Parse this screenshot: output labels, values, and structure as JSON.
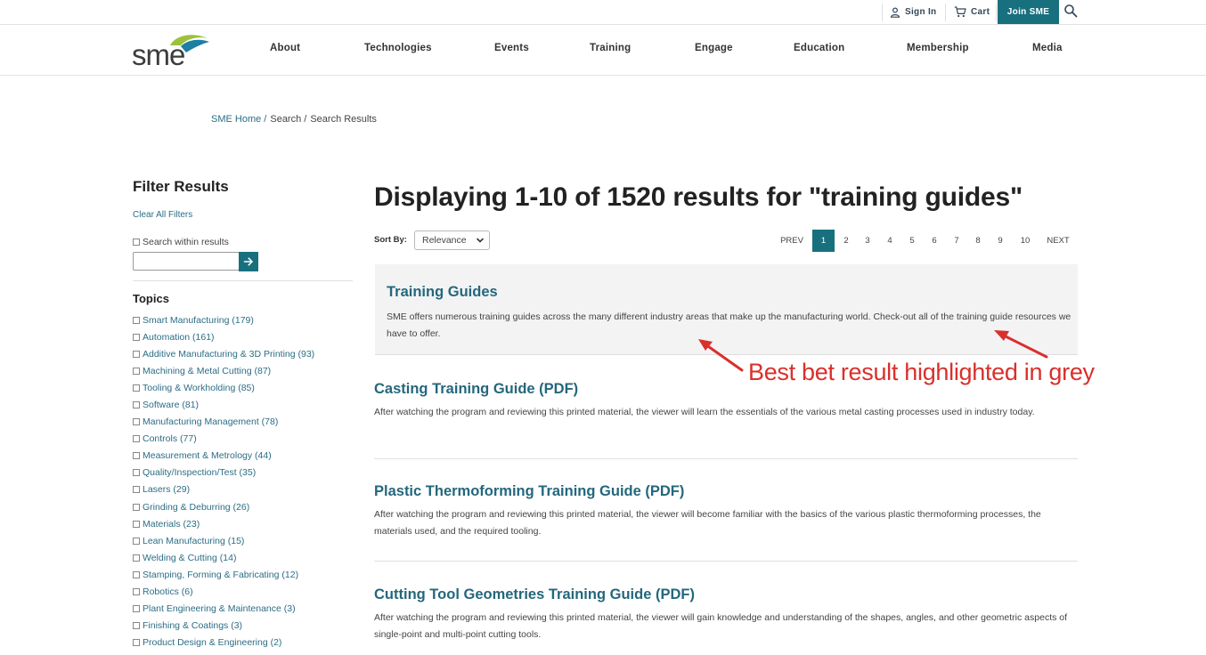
{
  "utility": {
    "sign_in": "Sign In",
    "cart": "Cart",
    "join": "Join SME"
  },
  "logo_text": "sme",
  "nav": [
    "About",
    "Technologies",
    "Events",
    "Training",
    "Engage",
    "Education",
    "Membership",
    "Media"
  ],
  "breadcrumb": {
    "home": "SME Home /",
    "search": "Search /",
    "current": "Search Results"
  },
  "sidebar": {
    "title": "Filter Results",
    "clear": "Clear All Filters",
    "search_within": "Search within results",
    "topics_title": "Topics",
    "topics": [
      "Smart Manufacturing (179)",
      "Automation (161)",
      "Additive Manufacturing & 3D Printing (93)",
      "Machining & Metal Cutting (87)",
      "Tooling & Workholding (85)",
      "Software (81)",
      "Manufacturing Management (78)",
      "Controls (77)",
      "Measurement & Metrology (44)",
      "Quality/Inspection/Test (35)",
      "Lasers (29)",
      "Grinding & Deburring (26)",
      "Materials (23)",
      "Lean Manufacturing (15)",
      "Welding & Cutting (14)",
      "Stamping, Forming & Fabricating (12)",
      "Robotics (6)",
      "Plant Engineering & Maintenance (3)",
      "Finishing & Coatings (3)",
      "Product Design & Engineering (2)"
    ]
  },
  "results": {
    "heading": "Displaying 1-10 of 1520 results for \"training guides\"",
    "sort_label": "Sort By:",
    "sort_value": "Relevance",
    "pager": {
      "prev": "PREV",
      "pages": [
        "1",
        "2",
        "3",
        "4",
        "5",
        "6",
        "7",
        "8",
        "9",
        "10"
      ],
      "next": "NEXT",
      "active": "1"
    },
    "best_bet": {
      "title": "Training Guides",
      "desc": "SME offers numerous training guides across the many different industry areas that make up the manufacturing world. Check-out all of the training guide resources we have to offer."
    },
    "items": [
      {
        "title": "Casting Training Guide (PDF)",
        "desc": "After watching the program and reviewing this printed material, the viewer will learn the essentials of the various metal casting processes used in industry today."
      },
      {
        "title": "Plastic Thermoforming Training Guide (PDF)",
        "desc": "After watching the program and reviewing this printed material, the viewer will become familiar with the basics of the various plastic thermoforming processes, the materials used, and the required tooling."
      },
      {
        "title": "Cutting Tool Geometries Training Guide (PDF)",
        "desc": "After watching the program and reviewing this printed material, the viewer will gain knowledge and understanding of the shapes, angles, and other geometric aspects of single-point and multi-point cutting tools."
      }
    ]
  },
  "annotation": {
    "text": "Best bet result highlighted in grey",
    "color": "#d9302b"
  },
  "colors": {
    "accent": "#18707f",
    "link": "#24677c",
    "bestbet_bg": "#f3f3f4"
  }
}
